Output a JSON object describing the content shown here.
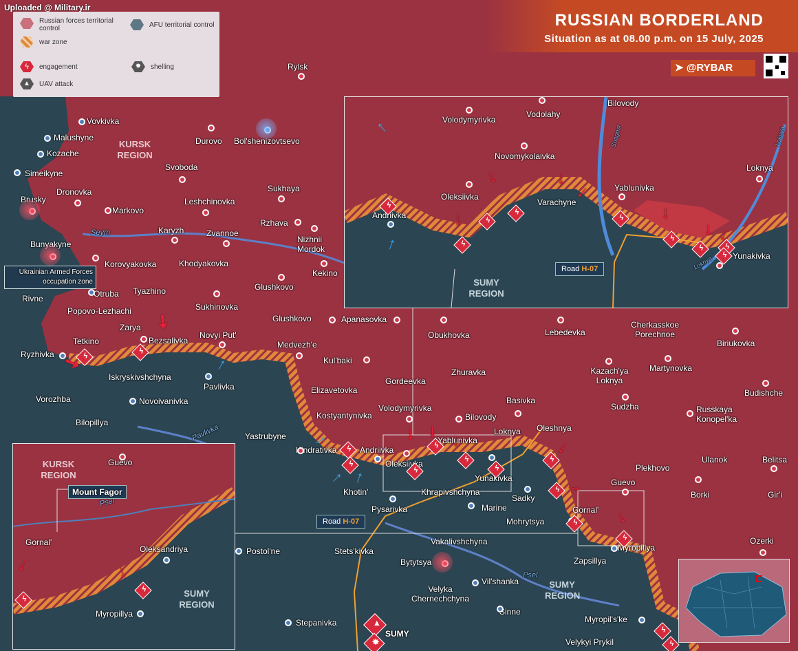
{
  "watermark": "Uploaded @ Military.ir",
  "header": {
    "title": "RUSSIAN BORDERLAND",
    "subtitle": "Situation as at 08.00 p.m. on 15 July, 2025",
    "brand": "@RYBAR"
  },
  "legend": {
    "russian": "Russian forces territorial control",
    "afu": "AFU territorial control",
    "warzone": "war zone",
    "engagement": "engagement",
    "shelling": "shelling",
    "uav": "UAV attack"
  },
  "regions": {
    "kursk_main": "KURSK REGION",
    "sumy_main": "SUMY REGION",
    "sumy_inset1": "SUMY REGION",
    "kursk_inset2": "KURSK REGION",
    "sumy_inset2": "SUMY REGION"
  },
  "annotations": {
    "occupation_zone": "Ukrainian Armed Forces occupation zone",
    "mount_fagor": "Mount Fagor",
    "road_prefix": "Road ",
    "road_code": "H-07"
  },
  "rivers": {
    "seym": "Seym",
    "psel_main": "Psel",
    "pavlivka": "Pavlivka",
    "psel_inset": "Psel",
    "shapsi": "Snagost",
    "loknya_inset": "Loknya",
    "loknya_inset2": "Loknya"
  },
  "places": {
    "rylsk": "Rylsk",
    "vovkivka": "Vovkivka",
    "malushyne": "Malushyne",
    "kozache": "Kozache",
    "simeikyne": "Simeikyne",
    "dronovka": "Dronovka",
    "brusky": "Brusky",
    "markovo": "Markovo",
    "durovo": "Durovo",
    "bolshenizovtsevo": "Bol'shenizovtsevo",
    "svoboda": "Svoboda",
    "sukhaya": "Sukhaya",
    "leshchinovka": "Leshchinovka",
    "rzhava": "Rzhava",
    "karyzh": "Karyzh",
    "zvannoe": "Zvannoe",
    "nizhnii_mordok": "Nizhnii Mordok",
    "bunyakyne": "Bunyakyne",
    "korovyakovka": "Korovyakovka",
    "khodyakovka": "Khodyakovka",
    "kekino": "Kekino",
    "glushkovo": "Glushkovo",
    "otruba": "Otruba",
    "tyazhino": "Tyazhino",
    "rivne": "Rivne",
    "popovo": "Popovo-Lezhachi",
    "sukhinovka": "Sukhinovka",
    "glushkovo2": "Glushkovo",
    "apanasovka": "Apanasovka",
    "zarya": "Zarya",
    "bezsalivka": "Bezsalivka",
    "novyi_put": "Novyi Put'",
    "medvezhe": "Medvezh'e",
    "tetkino": "Tetkino",
    "ryzhivka": "Ryzhivka",
    "iskryskivshchyna": "Iskryskivshchyna",
    "pavlivka": "Pavlivka",
    "kulbaki": "Kul'baki",
    "obukhovka": "Obukhovka",
    "lebedevka": "Lebedevka",
    "cherkasskoe": "Cherkasskoe Porechnoe",
    "biriukovka": "Biriukovka",
    "zhuravka": "Zhuravka",
    "gordeevka": "Gordeevka",
    "kazachya": "Kazach'ya Loknya",
    "martynovka": "Martynovka",
    "vorozhba": "Vorozhba",
    "novoivanivka": "Novoivanivka",
    "elizavetovka": "Elizavetovka",
    "budishche": "Budishche",
    "basivka": "Basivka",
    "sudzha": "Sudzha",
    "bilopillya": "Bilopillya",
    "kostyantynivka": "Kostyantynivka",
    "volodymyrivka": "Volodymyrivka",
    "bilovody": "Bilovody",
    "russkaya": "Russkaya Konopel'ka",
    "oleshnya": "Oleshnya",
    "yastrubyne": "Yastrubyne",
    "yablunivka": "Yablunivka",
    "loknya": "Loknya",
    "kindrativka": "Kindrativka",
    "andriivka": "Andriivka",
    "oleksiivka": "Oleksiivka",
    "ulanok": "Ulanok",
    "belitsa": "Belitsa",
    "plekhovo": "Plekhovo",
    "yunakivka": "Yunakivka",
    "guevo": "Guevo",
    "khotin": "Khotin'",
    "khrapivshchyna": "Khrapivshchyna",
    "sadky": "Sadky",
    "borki": "Borki",
    "giri": "Gir'i",
    "marine": "Marine",
    "pysarivka": "Pysarivka",
    "gornal": "Gornal'",
    "mohrytsya": "Mohrytsya",
    "vakalivshchyna": "Vakalivshchyna",
    "ozerki": "Ozerki",
    "postolne": "Postol'ne",
    "stetskivka": "Stets'kivka",
    "myropillya": "Myropillya",
    "bytytsya": "Bytytsya",
    "zapsillya": "Zapsillya",
    "vilshanka": "Vil'shanka",
    "velyka": "Velyka Chernechchyna",
    "sinne": "Sinne",
    "myropilske": "Myropil's'ke",
    "stepanivka": "Stepanivka",
    "sumy": "SUMY",
    "velykyi_prykil": "Velykyi Prykil"
  },
  "inset_ne": {
    "volodymyrivka": "Volodymyrivka",
    "vodolahy": "Vodolahy",
    "bilovody": "Bilovody",
    "novomykolaivka": "Novomykolaivka",
    "loknya": "Loknya",
    "oleksiivka": "Oleksiivka",
    "yablunivka": "Yablunivka",
    "varachyne": "Varachyne",
    "andriivka": "Andriivka",
    "yunakivka": "Yunakivka"
  },
  "inset_sw": {
    "guevo": "Guevo",
    "gornal": "Gornal'",
    "oleksandriya": "Oleksandriya",
    "myropillya": "Myropillya"
  },
  "colors": {
    "russian": "#9b3242",
    "afu": "#2c4552",
    "warzone": "#e0893a",
    "engagement": "#d8283c",
    "accent": "#c54a24"
  }
}
